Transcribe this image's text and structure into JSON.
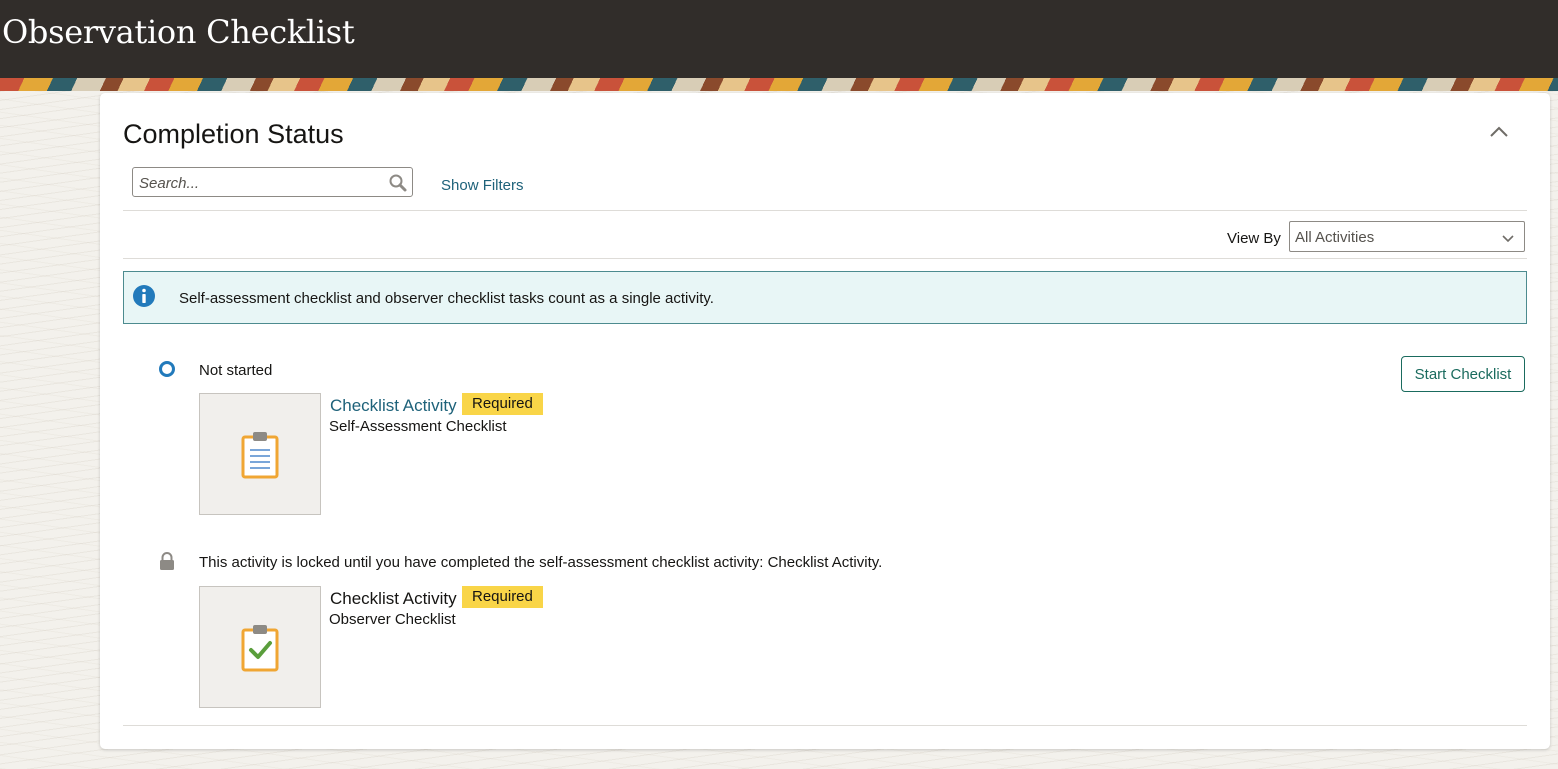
{
  "header": {
    "title": "Observation Checklist"
  },
  "section": {
    "title": "Completion Status",
    "collapse_icon": "chevron-up-icon"
  },
  "search": {
    "placeholder": "Search...",
    "value": "",
    "icon": "search-icon"
  },
  "filters": {
    "show_label": "Show Filters"
  },
  "view_by": {
    "label": "View By",
    "selected": "All Activities"
  },
  "info": {
    "icon": "info-icon",
    "message": "Self-assessment checklist and observer checklist tasks count as a single activity."
  },
  "activities": [
    {
      "status": "Not started",
      "status_icon": "status-ring-icon",
      "title": "Checklist Activity",
      "badge": "Required",
      "type": "Self-Assessment Checklist",
      "thumbnail_icon": "clipboard-list-icon",
      "action_label": "Start Checklist"
    },
    {
      "status": "This activity is locked until you have completed the self-assessment checklist activity: Checklist Activity.",
      "status_icon": "lock-icon",
      "title": "Checklist Activity",
      "badge": "Required",
      "type": "Observer Checklist",
      "thumbnail_icon": "clipboard-check-icon"
    }
  ],
  "colors": {
    "header_bg": "#312d2a",
    "link": "#1e627a",
    "badge": "#f9d548",
    "info_bg": "#e8f6f6",
    "button_text": "#1a6b5e"
  }
}
